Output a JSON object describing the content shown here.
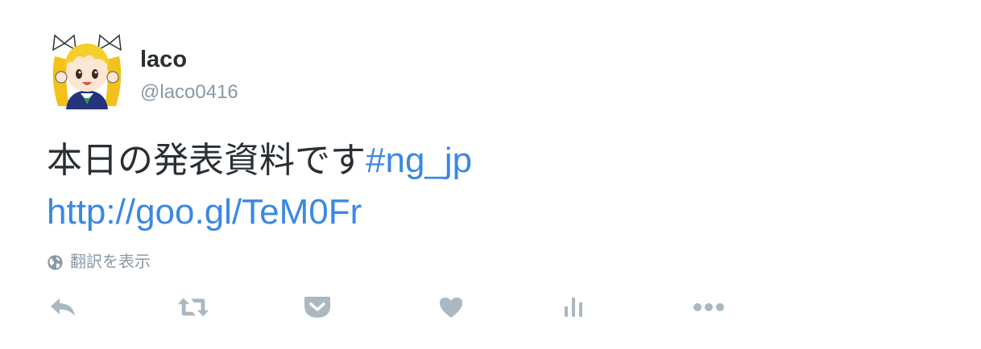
{
  "user": {
    "name": "laco",
    "handle": "@laco0416"
  },
  "tweet": {
    "text": "本日の発表資料です",
    "hashtag": "#ng_jp",
    "url": "http://goo.gl/TeM0Fr"
  },
  "translate": {
    "label": "翻訳を表示",
    "icon": "globe-icon"
  },
  "actions": [
    {
      "name": "reply",
      "icon": "reply-icon"
    },
    {
      "name": "retweet",
      "icon": "retweet-icon"
    },
    {
      "name": "pocket",
      "icon": "pocket-icon"
    },
    {
      "name": "like",
      "icon": "heart-icon"
    },
    {
      "name": "analytics",
      "icon": "bar-chart-icon"
    },
    {
      "name": "more",
      "icon": "more-icon"
    }
  ],
  "colors": {
    "text": "#292f33",
    "muted": "#8899a6",
    "link": "#3b88e3",
    "icon": "#aab8c2"
  }
}
